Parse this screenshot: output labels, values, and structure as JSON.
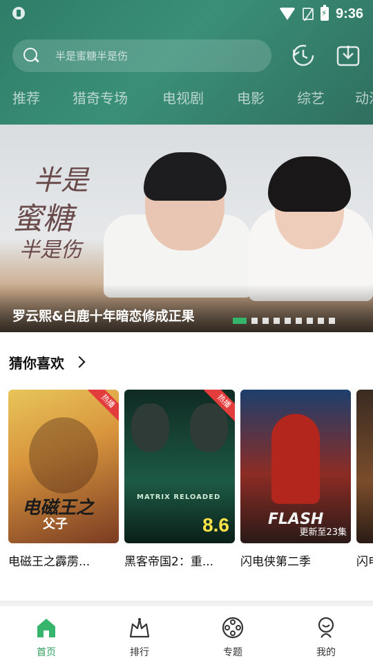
{
  "status_bar": {
    "time": "9:36"
  },
  "search": {
    "placeholder": "半是蜜糖半是伤"
  },
  "category_tabs": [
    "推荐",
    "猎奇专场",
    "电视剧",
    "电影",
    "综艺",
    "动漫"
  ],
  "banner": {
    "art_title_lines": [
      "半是",
      "蜜糖",
      "半是伤"
    ],
    "caption": "罗云熙&白鹿十年暗恋修成正果",
    "dot_count": 9,
    "active_dot_index": 0
  },
  "recommend": {
    "title": "猜你喜欢",
    "cards": [
      {
        "title": "电磁王之霹雳...",
        "badge": "热播",
        "poster_text": "电磁王之",
        "poster_subtext": "父子"
      },
      {
        "title": "黑客帝国2：重...",
        "badge": "热播",
        "poster_text": "MATRIX RELOADED",
        "rating": "8.6"
      },
      {
        "title": "闪电侠第二季",
        "poster_text": "FLASH",
        "update": "更新至23集"
      },
      {
        "title": "闪电..."
      }
    ]
  },
  "bottom_nav": [
    {
      "label": "首页",
      "active": true
    },
    {
      "label": "排行",
      "active": false
    },
    {
      "label": "专题",
      "active": false
    },
    {
      "label": "我的",
      "active": false
    }
  ],
  "colors": {
    "header": "#2e7d68",
    "accent": "#35b56a",
    "hot_badge": "#e23c3c"
  }
}
